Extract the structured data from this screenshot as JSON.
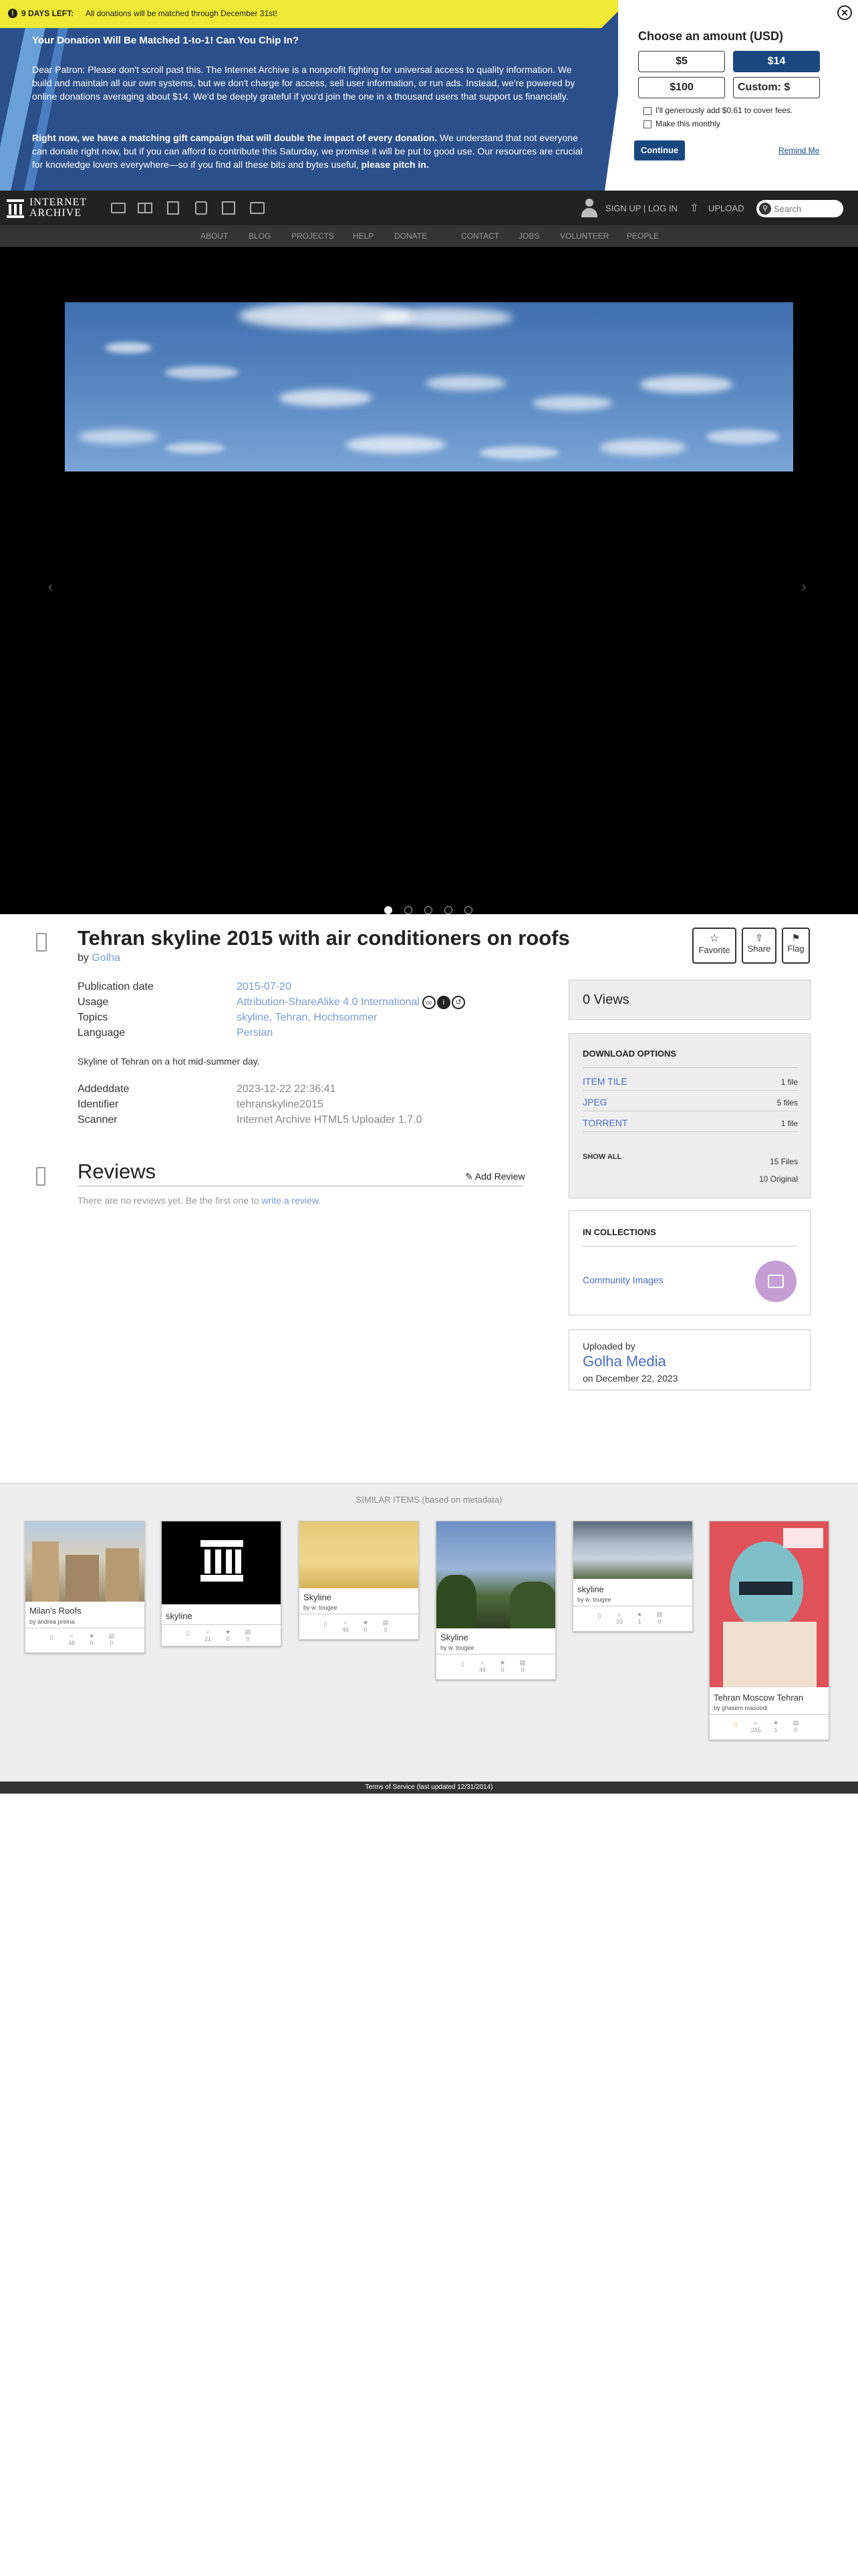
{
  "banner": {
    "days_left": "9 DAYS LEFT:",
    "match_note": "All donations will be matched through December 31st!",
    "headline": "Your Donation Will Be Matched 1-to-1! Can You Chip In?",
    "para1": "Dear Patron: Please don't scroll past this. The Internet Archive is a nonprofit fighting for universal access to quality information. We build and maintain all our own systems, but we don't charge for access, sell user information, or run ads. Instead, we're powered by online donations averaging about $14. We'd be deeply grateful if you'd join the one in a thousand users that support us financially.",
    "para2_bold": "Right now, we have a matching gift campaign that will double the impact of every donation.",
    "para2_rest": " We understand that not everyone can donate right now, but if you can afford to contribute this Saturday, we promise it will be put to good use. Our resources are crucial for knowledge lovers everywhere—so if you find all these bits and bytes useful,",
    "para2_end": "please pitch in.",
    "choose": "Choose an amount (USD)",
    "amounts": [
      "$5",
      "$14",
      "$100",
      "Custom: $"
    ],
    "selected_amount": "$14",
    "cover_fees": "I'll generously add $0.61 to cover fees.",
    "monthly": "Make this monthly",
    "continue": "Continue",
    "remind": "Remind Me",
    "close_icon": "close-icon"
  },
  "nav": {
    "logo_line1": "INTERNET",
    "logo_line2": "ARCHIVE",
    "signup": "SIGN UP | LOG IN",
    "upload": "UPLOAD",
    "search_placeholder": "Search",
    "links": [
      "ABOUT",
      "BLOG",
      "PROJECTS",
      "HELP",
      "DONATE",
      "CONTACT",
      "JOBS",
      "VOLUNTEER",
      "PEOPLE"
    ],
    "accent_red": "#d9302c"
  },
  "item": {
    "title": "Tehran skyline 2015 with air conditioners on roofs",
    "by_label": "by",
    "creator": "Golha",
    "favorite": "Favorite",
    "share": "Share",
    "flag": "Flag",
    "meta": [
      {
        "label": "Publication date",
        "value": "2015-07-20"
      },
      {
        "label": "Usage",
        "value": "Attribution-ShareAlike 4.0 International"
      },
      {
        "label": "Topics",
        "value": "skyline, Tehran, Hochsommer"
      },
      {
        "label": "Language",
        "value": "Persian"
      }
    ],
    "description": "Skyline of Tehran on a hot mid-summer day.",
    "meta2": [
      {
        "label": "Addeddate",
        "value": "2023-12-22 22:36:41"
      },
      {
        "label": "Identifier",
        "value": "tehranskyline2015"
      },
      {
        "label": "Scanner",
        "value": "Internet Archive HTML5 Uploader 1.7.0"
      }
    ],
    "reviews_title": "Reviews",
    "add_review": "Add Review",
    "no_reviews": "There are no reviews yet. Be the first one to",
    "write_review": "write a review."
  },
  "side": {
    "views": "0 Views",
    "download_title": "DOWNLOAD OPTIONS",
    "downloads": [
      {
        "name": "ITEM TILE",
        "count": "1 file"
      },
      {
        "name": "JPEG",
        "count": "5 files"
      },
      {
        "name": "TORRENT",
        "count": "1 file"
      }
    ],
    "show_all": "SHOW ALL",
    "files_total": "15 Files",
    "original": "10 Original",
    "collections_title": "IN COLLECTIONS",
    "collection": "Community Images",
    "uploaded_by": "Uploaded by",
    "uploader": "Golha Media",
    "upload_date": "on December 22, 2023"
  },
  "similar": {
    "heading": "SIMILAR ITEMS (based on metadata)",
    "items": [
      {
        "title": "Milan's Roofs",
        "by": "by andrea preina",
        "views": "48",
        "favs": "0",
        "reviews": "0"
      },
      {
        "title": "skyline",
        "by": "",
        "views": "21",
        "favs": "0",
        "reviews": "0"
      },
      {
        "title": "Skyline",
        "by": "by w. tougee",
        "views": "46",
        "favs": "0",
        "reviews": "0"
      },
      {
        "title": "Skyline",
        "by": "by w. tougee",
        "views": "46",
        "favs": "0",
        "reviews": "0"
      },
      {
        "title": "skyline",
        "by": "by w. tougee",
        "views": "33",
        "favs": "1",
        "reviews": "0"
      },
      {
        "title": "Tehran Moscow Tehran",
        "by": "by ghasem masoodi",
        "views": "245",
        "favs": "1",
        "reviews": "0"
      }
    ]
  },
  "footer": {
    "terms": "Terms of Service (last updated 12/31/2014)"
  }
}
